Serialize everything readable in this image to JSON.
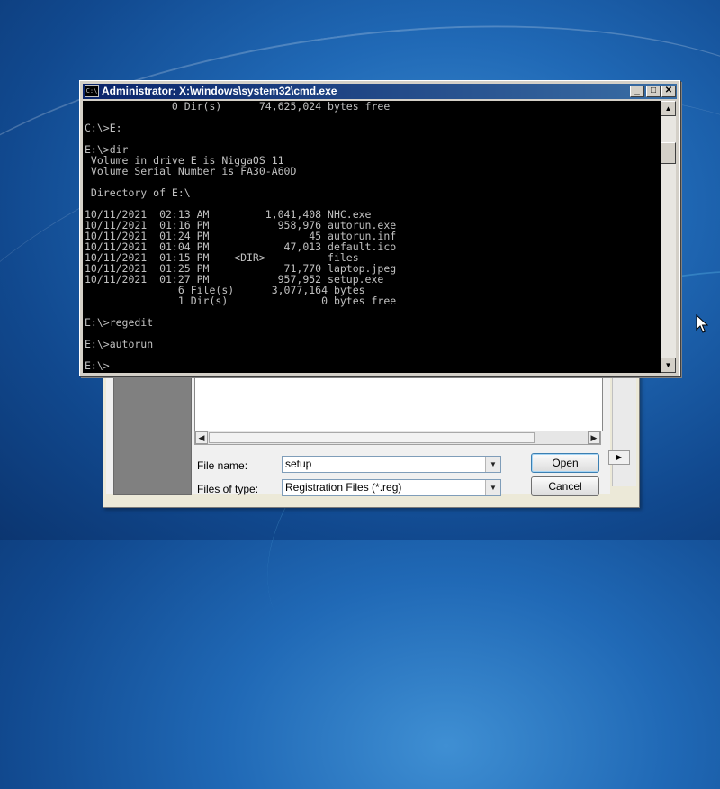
{
  "cmd_window": {
    "title": "Administrator: X:\\windows\\system32\\cmd.exe",
    "icon_text": "C:\\",
    "controls": {
      "minimize": "_",
      "maximize": "□",
      "close": "✕"
    },
    "console_lines": [
      "              0 Dir(s)      74,625,024 bytes free",
      "",
      "C:\\>E:",
      "",
      "E:\\>dir",
      " Volume in drive E is NiggaOS 11",
      " Volume Serial Number is FA30-A60D",
      "",
      " Directory of E:\\",
      "",
      "10/11/2021  02:13 AM         1,041,408 NHC.exe",
      "10/11/2021  01:16 PM           958,976 autorun.exe",
      "10/11/2021  01:24 PM                45 autorun.inf",
      "10/11/2021  01:04 PM            47,013 default.ico",
      "10/11/2021  01:15 PM    <DIR>          files",
      "10/11/2021  01:25 PM            71,770 laptop.jpeg",
      "10/11/2021  01:27 PM           957,952 setup.exe",
      "               6 File(s)      3,077,164 bytes",
      "               1 Dir(s)               0 bytes free",
      "",
      "E:\\>regedit",
      "",
      "E:\\>autorun",
      "",
      "E:\\>"
    ],
    "scroll_up": "▲",
    "scroll_down": "▼"
  },
  "file_dialog": {
    "file_name_label": "File name:",
    "file_name_value": "setup",
    "file_type_label": "Files of type:",
    "file_type_value": "Registration Files (*.reg)",
    "open_label": "Open",
    "cancel_label": "Cancel",
    "dropdown_glyph": "▼",
    "scroll_left": "◀",
    "scroll_right": "▶"
  }
}
